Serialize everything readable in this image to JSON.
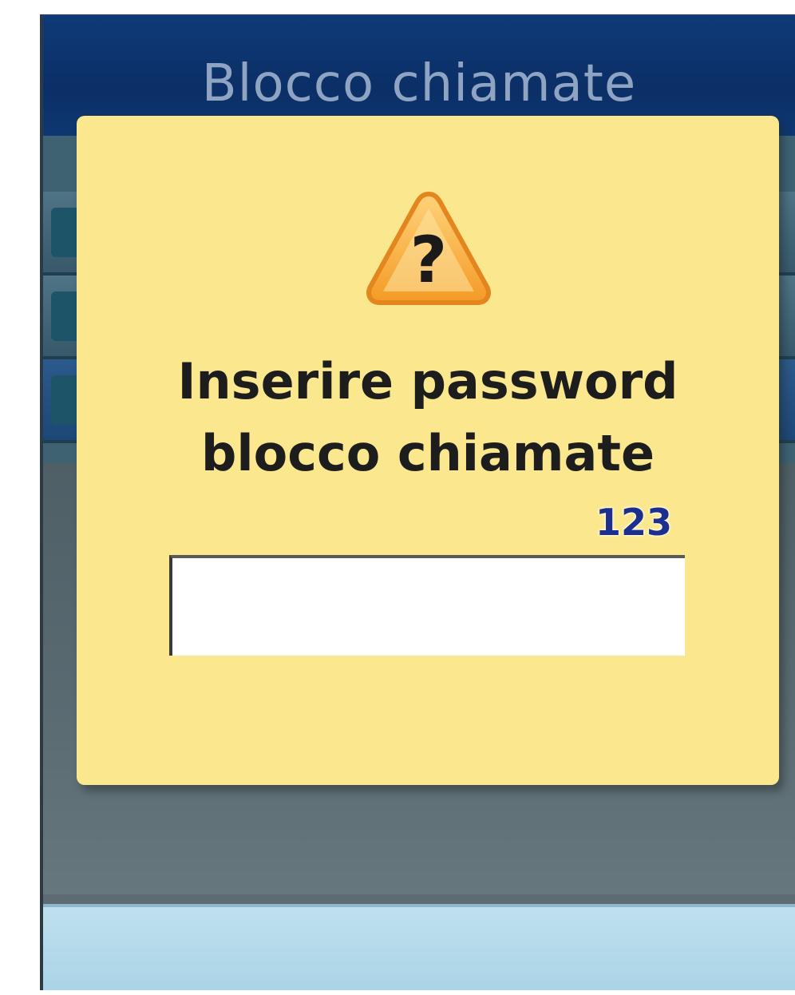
{
  "screen": {
    "title": "Blocco chiamate"
  },
  "menu": {
    "items": [
      {
        "number": "",
        "label": ""
      },
      {
        "number": "",
        "label": ""
      },
      {
        "number": "",
        "label": ""
      }
    ]
  },
  "dialog": {
    "icon": "warning-question-icon",
    "prompt_line1": "Inserire password",
    "prompt_line2": "blocco chiamate",
    "input_mode": "123",
    "password_value": ""
  },
  "colors": {
    "title_bar": "#0f3a78",
    "dialog_background": "#fbe88e",
    "warning_icon": "#f4a52a",
    "input_mode_text": "#1c2f8e",
    "soft_key_bar": "#bfe0ee"
  }
}
